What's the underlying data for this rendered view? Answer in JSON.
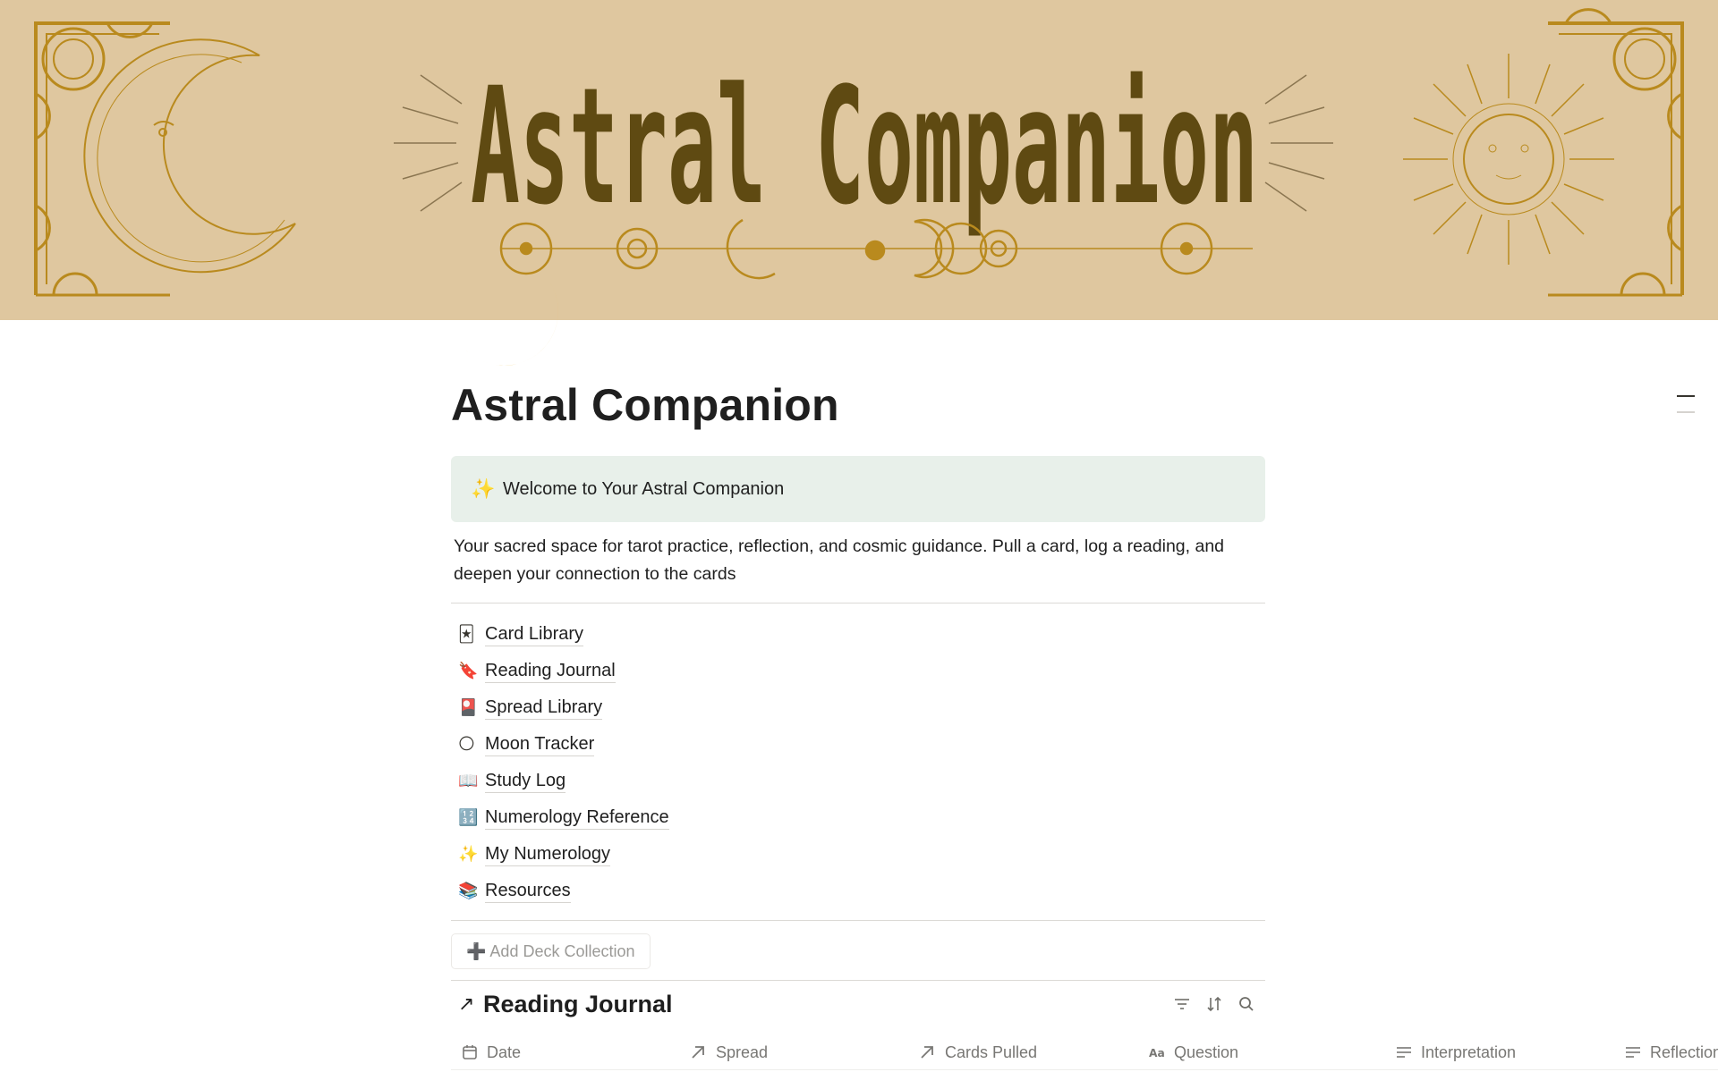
{
  "cover": {
    "banner_text": "Astral Companion",
    "background_color": "#dfc79f",
    "ornament_color": "#b98a1e",
    "title_color": "#5f4a12"
  },
  "page": {
    "icon": "crescent-moon-icon",
    "title": "Astral Companion"
  },
  "callout": {
    "emoji": "✨",
    "text": "Welcome to Your Astral Companion",
    "background": "#e8f0ea"
  },
  "intro": "Your sacred space for tarot practice, reflection, and cosmic guidance. Pull a card, log a reading, and deepen your connection to the cards",
  "nav": {
    "items": [
      {
        "emoji": "🃏",
        "label": "Card Library"
      },
      {
        "emoji": "🔖",
        "label": "Reading Journal"
      },
      {
        "emoji": "🎴",
        "label": "Spread Library"
      },
      {
        "emoji": "🌕",
        "label": "Moon Tracker"
      },
      {
        "emoji": "📖",
        "label": "Study Log"
      },
      {
        "emoji": "🔢",
        "label": "Numerology Reference"
      },
      {
        "emoji": "✨",
        "label": "My Numerology"
      },
      {
        "emoji": "📚",
        "label": "Resources"
      }
    ]
  },
  "add_button": {
    "label": "Add Deck Collection",
    "icon": "➕"
  },
  "database": {
    "arrow": "↗",
    "title": "Reading Journal",
    "tools": [
      "filter-icon",
      "sort-icon",
      "search-icon"
    ],
    "columns": [
      {
        "icon": "calendar-icon",
        "label": "Date"
      },
      {
        "icon": "relation-arrow-icon",
        "label": "Spread"
      },
      {
        "icon": "relation-arrow-icon",
        "label": "Cards Pulled"
      },
      {
        "icon": "title-text-icon",
        "label": "Question"
      },
      {
        "icon": "text-lines-icon",
        "label": "Interpretation"
      },
      {
        "icon": "text-lines-icon",
        "label": "Reflection"
      }
    ]
  }
}
